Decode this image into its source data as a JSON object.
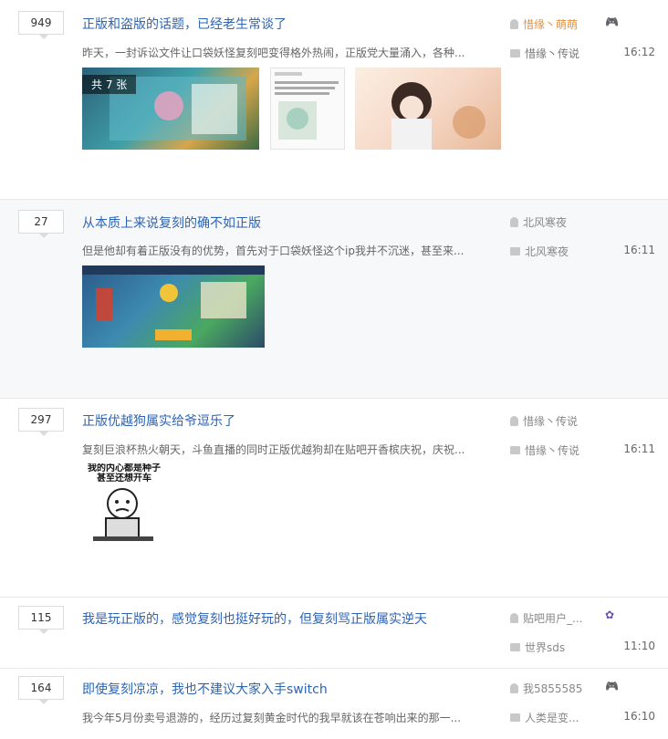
{
  "threads": [
    {
      "replies": "949",
      "title": "正版和盗版的话题，已经老生常谈了",
      "abstract": "昨天，一封诉讼文件让口袋妖怪复刻吧变得格外热闹，正版党大量涌入，各种...",
      "author": "惜缘丶萌萌",
      "last_reply": "惜缘丶传说",
      "time": "16:12",
      "image_count": "共 7 张"
    },
    {
      "replies": "27",
      "title": "从本质上来说复刻的确不如正版",
      "abstract": "但是他却有着正版没有的优势，首先对于口袋妖怪这个ip我并不沉迷，甚至来...",
      "author": "北风寒夜",
      "last_reply": "北风寒夜",
      "time": "16:11"
    },
    {
      "replies": "297",
      "title": "正版优越狗属实给爷逗乐了",
      "abstract": "复刻巨浪杯热火朝天，斗鱼直播的同时正版优越狗却在贴吧开香槟庆祝，庆祝...",
      "author": "惜缘丶传说",
      "last_reply": "惜缘丶传说",
      "time": "16:11",
      "meme_text": "我的内心都是种子\n甚至还想开车"
    },
    {
      "replies": "115",
      "title": "我是玩正版的，感觉复刻也挺好玩的，但复刻骂正版属实逆天",
      "author": "贴吧用户_...",
      "last_reply": "世界sds",
      "time": "11:10"
    },
    {
      "replies": "164",
      "title": "即使复刻凉凉，我也不建议大家入手switch",
      "abstract": "我今年5月份卖号退游的，经历过复刻黄金时代的我早就该在苍响出来的那一...",
      "author": "我5855585",
      "last_reply": "人类是变...",
      "time": "16:10"
    }
  ]
}
